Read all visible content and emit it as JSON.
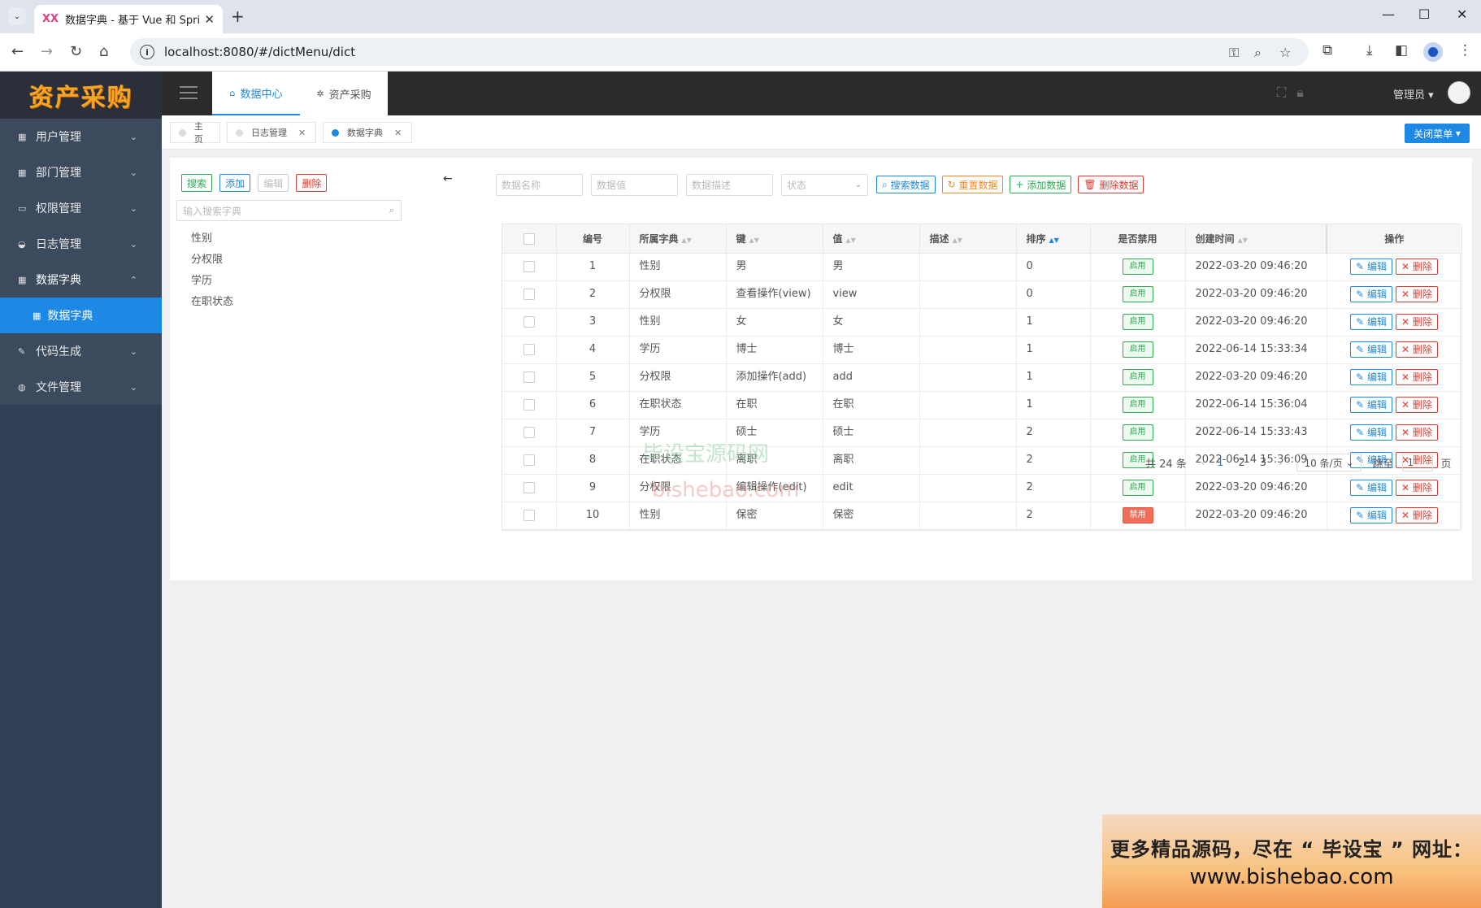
{
  "browser": {
    "tab_title": "数据字典 - 基于 Vue 和 Spring",
    "favicon_text": "XX",
    "url": "localhost:8080/#/dictMenu/dict"
  },
  "app": {
    "logo": "资产采购",
    "accent": "#1e88e5",
    "sidebar": {
      "items": [
        {
          "label": "用户管理",
          "icon": "user-icon"
        },
        {
          "label": "部门管理",
          "icon": "grid-icon"
        },
        {
          "label": "权限管理",
          "icon": "monitor-icon"
        },
        {
          "label": "日志管理",
          "icon": "log-icon"
        },
        {
          "label": "数据字典",
          "icon": "grid-icon",
          "open": true
        },
        {
          "label": "代码生成",
          "icon": "pencil-icon"
        },
        {
          "label": "文件管理",
          "icon": "globe-icon"
        }
      ],
      "sub_active": "数据字典"
    },
    "topnav": [
      {
        "label": "数据中心",
        "active": true
      },
      {
        "label": "资产采购",
        "active": false
      }
    ],
    "user": "管理员",
    "tags": [
      {
        "label": "主页"
      },
      {
        "label": "日志管理"
      },
      {
        "label": "数据字典"
      }
    ],
    "close_menu": "关闭菜单"
  },
  "left_panel": {
    "buttons": {
      "search": "搜索",
      "add": "添加",
      "edit": "编辑",
      "delete": "删除"
    },
    "search_placeholder": "输入搜索字典",
    "tree": [
      "性别",
      "分权限",
      "学历",
      "在职状态"
    ]
  },
  "filters": {
    "name_placeholder": "数据名称",
    "value_placeholder": "数据值",
    "desc_placeholder": "数据描述",
    "status_placeholder": "状态",
    "search_btn": "搜索数据",
    "reset_btn": "重置数据",
    "add_btn": "添加数据",
    "delete_btn": "删除数据"
  },
  "table": {
    "headers": {
      "id": "编号",
      "dict": "所属字典",
      "key": "键",
      "value": "值",
      "desc": "描述",
      "sort": "排序",
      "disabled": "是否禁用",
      "created": "创建时间",
      "ops": "操作"
    },
    "edit_label": "编辑",
    "delete_label": "删除",
    "rows": [
      {
        "id": "1",
        "dict": "性别",
        "key": "男",
        "value": "男",
        "desc": "",
        "sort": "0",
        "status": "启用",
        "on": true,
        "created": "2022-03-20 09:46:20"
      },
      {
        "id": "2",
        "dict": "分权限",
        "key": "查看操作(view)",
        "value": "view",
        "desc": "",
        "sort": "0",
        "status": "启用",
        "on": true,
        "created": "2022-03-20 09:46:20"
      },
      {
        "id": "3",
        "dict": "性别",
        "key": "女",
        "value": "女",
        "desc": "",
        "sort": "1",
        "status": "启用",
        "on": true,
        "created": "2022-03-20 09:46:20"
      },
      {
        "id": "4",
        "dict": "学历",
        "key": "博士",
        "value": "博士",
        "desc": "",
        "sort": "1",
        "status": "启用",
        "on": true,
        "created": "2022-06-14 15:33:34"
      },
      {
        "id": "5",
        "dict": "分权限",
        "key": "添加操作(add)",
        "value": "add",
        "desc": "",
        "sort": "1",
        "status": "启用",
        "on": true,
        "created": "2022-03-20 09:46:20"
      },
      {
        "id": "6",
        "dict": "在职状态",
        "key": "在职",
        "value": "在职",
        "desc": "",
        "sort": "1",
        "status": "启用",
        "on": true,
        "created": "2022-06-14 15:36:04"
      },
      {
        "id": "7",
        "dict": "学历",
        "key": "硕士",
        "value": "硕士",
        "desc": "",
        "sort": "2",
        "status": "启用",
        "on": true,
        "created": "2022-06-14 15:33:43"
      },
      {
        "id": "8",
        "dict": "在职状态",
        "key": "离职",
        "value": "离职",
        "desc": "",
        "sort": "2",
        "status": "启用",
        "on": true,
        "created": "2022-06-14 15:36:09"
      },
      {
        "id": "9",
        "dict": "分权限",
        "key": "编辑操作(edit)",
        "value": "edit",
        "desc": "",
        "sort": "2",
        "status": "启用",
        "on": true,
        "created": "2022-03-20 09:46:20"
      },
      {
        "id": "10",
        "dict": "性别",
        "key": "保密",
        "value": "保密",
        "desc": "",
        "sort": "2",
        "status": "禁用",
        "on": false,
        "created": "2022-03-20 09:46:20"
      }
    ]
  },
  "pagination": {
    "total": "共 24 条",
    "pages": [
      "1",
      "2",
      "3"
    ],
    "current": "1",
    "page_size": "10 条/页",
    "jump_label": "跳至",
    "jump_value": "1",
    "page_unit": "页"
  },
  "watermark": {
    "cn": "毕设宝源码网",
    "en": "bishebao.com"
  },
  "ad": {
    "line1": "更多精品源码，尽在 “ 毕设宝 ” 网址：",
    "line2": "www.bishebao.com"
  }
}
